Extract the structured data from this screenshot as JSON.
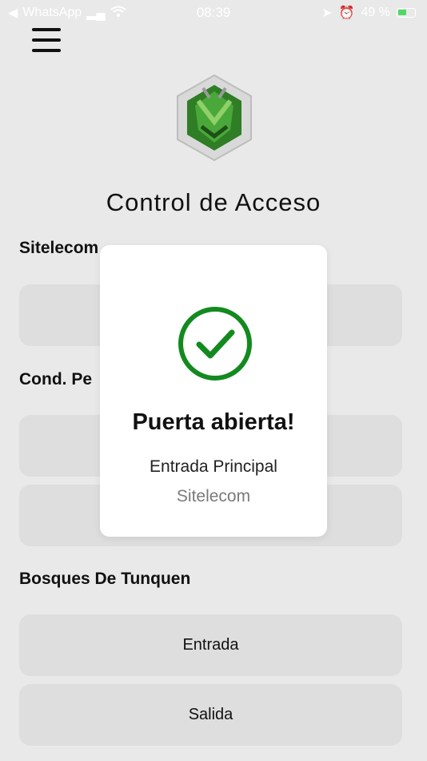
{
  "status_bar": {
    "back_app": "WhatsApp",
    "time": "08:39",
    "battery": "49 %"
  },
  "app": {
    "title": "Control de Acceso",
    "menu_icon": "hamburger-menu-icon",
    "logo_icon": "insect-hexagon-logo"
  },
  "sections": [
    {
      "title": "Sitelecom",
      "doors": [
        ""
      ]
    },
    {
      "title": "Cond. Pe",
      "doors": [
        "",
        ""
      ]
    },
    {
      "title": "Bosques De Tunquen",
      "doors": [
        "Entrada",
        "Salida"
      ]
    }
  ],
  "modal": {
    "icon": "check-circle-icon",
    "title": "Puerta abierta!",
    "door": "Entrada Principal",
    "site": "Sitelecom"
  },
  "colors": {
    "background": "#e9e9e9",
    "button": "#dedede",
    "success": "#138a1f",
    "logo_green": "#3a9a2e"
  }
}
